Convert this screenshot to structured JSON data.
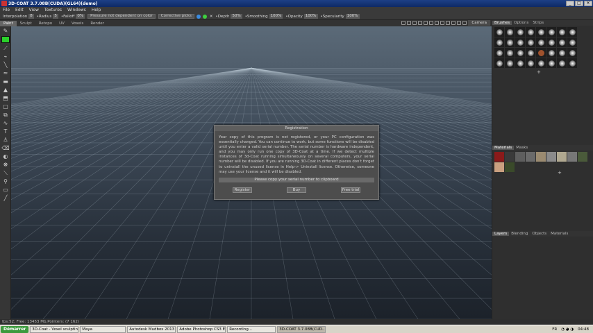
{
  "window": {
    "title": "3D-COAT 3.7.08B(CUDA)(GL64)(demo)",
    "minimize": "_",
    "maximize": "□",
    "close": "✕"
  },
  "menu": [
    "File",
    "Edit",
    "View",
    "Textures",
    "Windows",
    "Help"
  ],
  "options": {
    "interpolation_label": "Interpolation",
    "interpolation_value": "8",
    "radius_label": "•Radius",
    "radius_value": "5",
    "falloff_label": "•Falloff",
    "falloff_value": "0%",
    "pressure_select": "Pressure not dependent on color",
    "corrective_select": "Corrective picks",
    "depth_label": "•Depth",
    "depth_value": "50%",
    "smoothing_label": "•Smoothing",
    "smoothing_value": "100%",
    "opacity_label": "•Opacity",
    "opacity_value": "100%",
    "specularity_label": "•Specularity",
    "specularity_value": "100%"
  },
  "tabs": [
    "Paint",
    "Sculpt",
    "Retopo",
    "UV",
    "Voxels",
    "Render"
  ],
  "active_tab": "Paint",
  "camera_label": "Camera",
  "dialog": {
    "title": "Registration",
    "message": "Your copy of this program is not registered, or your PC configuration was essentially changed. You can continue to work, but some functions will be disabled until you enter a valid serial number. The serial number is hardware independent, and you may only run one copy of 3D-Coat at a time. If we detect multiple instances of 3d-Coat running simultaneously on several computers, your serial number will be disabled. If you are running 3D-Coat in different places don't forget to uninstall the unused license in Help-> Uninstall license. Otherwise, someone may use your license and it will be disabled.",
    "copy_button": "Please copy your serial number to clipboard",
    "register_button": "Register",
    "buy_button": "Buy",
    "trial_button": "Free trial"
  },
  "brushes_panel": {
    "tabs": [
      "Brushes",
      "Options",
      "Strips"
    ],
    "add_symbol": "+"
  },
  "materials_panel": {
    "tabs": [
      "Materials",
      "Masks"
    ],
    "add_symbol": "+"
  },
  "layers_panel": {
    "tabs": [
      "Layers",
      "Blending",
      "Objects",
      "Materials"
    ]
  },
  "status": "fps:52;    Free: 13453 Mb,Pointers: (7 162)",
  "taskbar": {
    "start": "Démarrer",
    "tasks": [
      "3D-Coat - Voxel sculptin...",
      "Maya",
      "Autodesk Mudbox 2013 ...",
      "Adobe Photoshop CS3 E...",
      "Recording...",
      "3D-COAT 3.7.08B(CUD..."
    ],
    "language": "FR",
    "clock": "04:48"
  },
  "colors": {
    "primary_color": "#2bd12b",
    "dialog_bg": "#4d4d4d",
    "viewport_top": "#5b6a78",
    "viewport_bottom": "#1c222a"
  }
}
